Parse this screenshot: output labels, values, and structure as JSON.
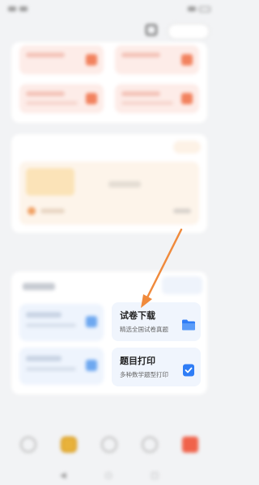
{
  "tools": {
    "items": [
      {
        "name": "试卷下载",
        "desc": "精选全国试卷真题",
        "icon": "folder-icon"
      },
      {
        "name": "题目打印",
        "desc": "多种数学题型打印",
        "icon": "checklist-icon"
      }
    ]
  },
  "colors": {
    "accent_blue": "#2f7df6",
    "annotation_arrow": "#f08a3c",
    "tool_card_bg": "#f0f5fd"
  }
}
